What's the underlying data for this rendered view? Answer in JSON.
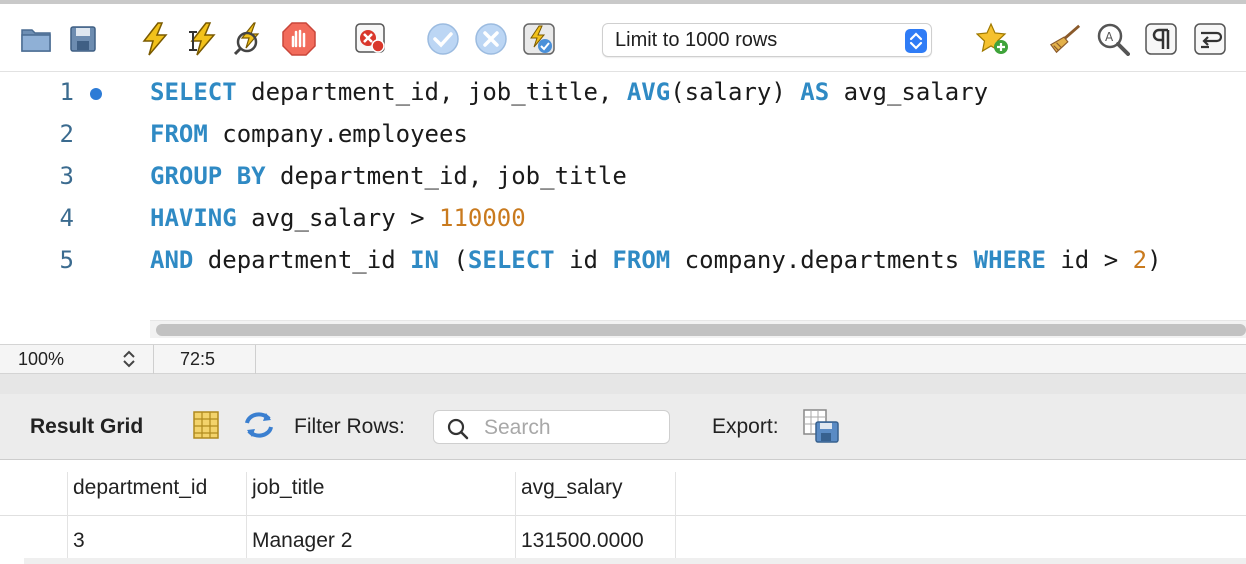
{
  "toolbar": {
    "limit_select_value": "Limit to 1000 rows",
    "icons": [
      "open-file-icon",
      "save-icon",
      "execute-icon",
      "execute-current-icon",
      "explain-icon",
      "stop-icon",
      "toggle-error-icon",
      "commit-icon",
      "rollback-icon",
      "autocommit-icon",
      "add-snippet-icon",
      "beautify-icon",
      "find-icon",
      "invisible-chars-icon",
      "wrap-lines-icon"
    ]
  },
  "editor": {
    "line_numbers": [
      "1",
      "2",
      "3",
      "4",
      "5"
    ],
    "lines": [
      [
        {
          "t": "SELECT",
          "k": "kw"
        },
        {
          "t": " department_id, job_title, "
        },
        {
          "t": "AVG",
          "k": "kw"
        },
        {
          "t": "(salary) "
        },
        {
          "t": "AS",
          "k": "kw"
        },
        {
          "t": " avg_salary"
        }
      ],
      [
        {
          "t": "FROM",
          "k": "kw"
        },
        {
          "t": " company.employees"
        }
      ],
      [
        {
          "t": "GROUP BY",
          "k": "kw"
        },
        {
          "t": " department_id, job_title"
        }
      ],
      [
        {
          "t": "HAVING",
          "k": "kw"
        },
        {
          "t": " avg_salary > "
        },
        {
          "t": "110000",
          "k": "num"
        }
      ],
      [
        {
          "t": "AND",
          "k": "kw"
        },
        {
          "t": " department_id "
        },
        {
          "t": "IN",
          "k": "kw"
        },
        {
          "t": " ("
        },
        {
          "t": "SELECT",
          "k": "kw"
        },
        {
          "t": " id "
        },
        {
          "t": "FROM",
          "k": "kw"
        },
        {
          "t": " company.departments "
        },
        {
          "t": "WHERE",
          "k": "kw"
        },
        {
          "t": " id > "
        },
        {
          "t": "2",
          "k": "num"
        },
        {
          "t": ")"
        }
      ]
    ]
  },
  "status": {
    "zoom": "100%",
    "cursor_position": "72:5"
  },
  "result": {
    "grid_label": "Result Grid",
    "filter_label": "Filter Rows:",
    "search_placeholder": "Search",
    "export_label": "Export:",
    "columns": [
      "department_id",
      "job_title",
      "avg_salary"
    ],
    "rows": [
      [
        "3",
        "Manager 2",
        "131500.0000"
      ]
    ]
  },
  "colors": {
    "keyword": "#2f8ac4",
    "number": "#c97a1e",
    "accent": "#2f7cf6"
  }
}
